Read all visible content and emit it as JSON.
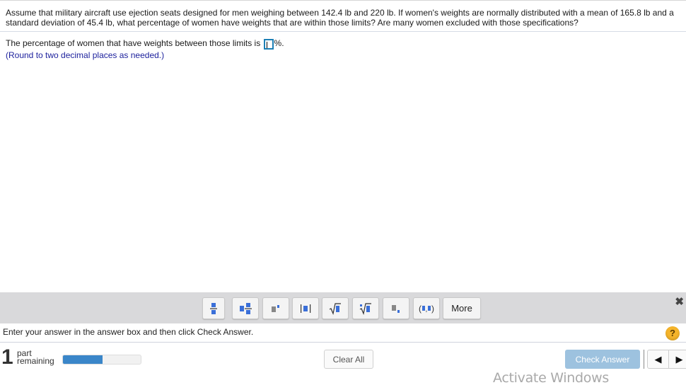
{
  "question": {
    "text": "Assume that military aircraft use ejection seats designed for men weighing between 142.4 lb and 220 lb. If women's weights are normally distributed with a mean of 165.8 lb and a standard deviation of 45.4 lb, what percentage of women have weights that are within those limits? Are many women excluded with those specifications?"
  },
  "answer": {
    "prefix": "The percentage of women that have weights between those limits is",
    "value": "",
    "suffix": "%.",
    "hint": "(Round to two decimal places as needed.)"
  },
  "toolbar": {
    "buttons": [
      {
        "name": "fraction-button",
        "icon": "fraction-icon"
      },
      {
        "name": "mixed-number-button",
        "icon": "mixed-number-icon"
      },
      {
        "name": "exponent-button",
        "icon": "exponent-icon"
      },
      {
        "name": "absolute-value-button",
        "icon": "absolute-value-icon"
      },
      {
        "name": "square-root-button",
        "icon": "square-root-icon"
      },
      {
        "name": "nth-root-button",
        "icon": "nth-root-icon"
      },
      {
        "name": "subscript-button",
        "icon": "subscript-icon"
      },
      {
        "name": "ordered-pair-button",
        "icon": "ordered-pair-icon"
      }
    ],
    "more_label": "More",
    "close_icon": "close-icon"
  },
  "status": {
    "message": "Enter your answer in the answer box and then click Check Answer.",
    "help_label": "?"
  },
  "footer": {
    "parts_count": "1",
    "parts_label_line1": "part",
    "parts_label_line2": "remaining",
    "progress_fraction": 0.51,
    "clear_all_label": "Clear All",
    "check_answer_label": "Check Answer",
    "prev_label": "◀",
    "next_label": "▶",
    "watermark": "Activate Windows"
  },
  "colors": {
    "accent_blue": "#3a86c9",
    "check_button": "#9dc2df",
    "hint_text": "#1b1f9c",
    "help_badge": "#f5b42a"
  }
}
